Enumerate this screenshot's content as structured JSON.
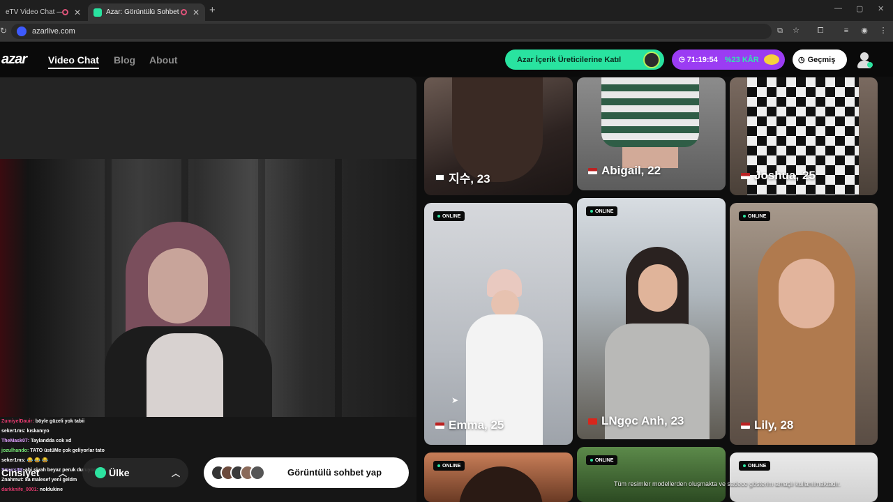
{
  "browser": {
    "tabs": [
      {
        "title": "eTV Video Chat — Ome",
        "active": false
      },
      {
        "title": "Azar: Görüntülü Sohbet & V",
        "active": true
      }
    ],
    "new_tab": "+",
    "close": "✕",
    "url": "azarlive.com",
    "window_controls": [
      "—",
      "▢",
      "✕"
    ]
  },
  "site": {
    "logo": "azar",
    "nav": [
      {
        "label": "Video Chat",
        "active": true
      },
      {
        "label": "Blog",
        "active": false
      },
      {
        "label": "About",
        "active": false
      }
    ],
    "join_label": "Azar İçerik Üreticilerine Katıl",
    "timer": "71:19:54",
    "discount": "%23 KÂR",
    "history_label": "Geçmiş",
    "accent": "#29e3a0",
    "promo_color": "#9b3cf3"
  },
  "chat": [
    {
      "user": "ZumiyelDauir:",
      "msg": "böyle güzeli yok tabii",
      "color": "#e63a6f"
    },
    {
      "user": "seker1ms:",
      "msg": "kıskanıyo",
      "color": "#ffffff"
    },
    {
      "user": "TheMask07:",
      "msg": "Taylandda cok xd",
      "color": "#e0a0ff"
    },
    {
      "user": "jozulhando:",
      "msg": "TATO üstüMe çok geliyorlar tato",
      "color": "#7cf07c"
    },
    {
      "user": "seker1ms:",
      "msg": "😂 😂 😂",
      "color": "#ffffff"
    },
    {
      "user": "Smurs39:",
      "msg": "abi siyah beyaz peruk duruyormu?",
      "color": "#c9a8ff"
    },
    {
      "user": "Znahmut:",
      "msg": "8a malesef yeni geldm",
      "color": "#ffffff"
    },
    {
      "user": "darkknife_0001:",
      "msg": "noldukine",
      "color": "#e63a6f"
    }
  ],
  "controls": {
    "gender_label": "Cinsiyet",
    "country_label": "Ülke",
    "start_label": "Görüntülü sohbet yap"
  },
  "profiles": [
    {
      "name": "지수, 23",
      "online": false
    },
    {
      "name": "Abigail, 22",
      "online": false
    },
    {
      "name": "Joshua, 25",
      "online": false
    },
    {
      "name": "Emma, 25",
      "online": true
    },
    {
      "name": "LNgọc Anh, 23",
      "online": true
    },
    {
      "name": "Lily, 28",
      "online": true
    },
    {
      "name": "",
      "online": true
    },
    {
      "name": "",
      "online": true
    },
    {
      "name": "",
      "online": true
    }
  ],
  "online_label": "ONLINE",
  "disclaimer": "Tüm resimler modellerden oluşmakta ve sadece gösterim amaçlı kullanılmaktadır."
}
